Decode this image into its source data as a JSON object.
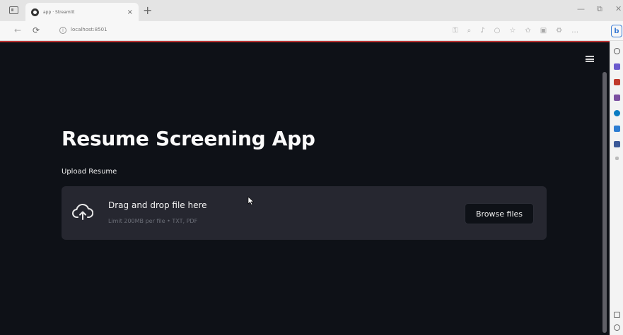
{
  "browser": {
    "tab_title": "app · Streamlit",
    "tab_close": "×",
    "new_tab": "+",
    "url": "localhost:8501",
    "bing_label": "b",
    "window_minimize": "—",
    "window_restore": "⧉",
    "window_close": "✕"
  },
  "app": {
    "title": "Resume Screening App",
    "uploader": {
      "label": "Upload Resume",
      "drop_title": "Drag and drop file here",
      "limit_text": "Limit 200MB per file • TXT, PDF",
      "browse_label": "Browse files"
    }
  },
  "colors": {
    "background": "#0e1117",
    "dropzone": "#262730",
    "text": "#fafafa",
    "header_accent": "#b33333"
  }
}
